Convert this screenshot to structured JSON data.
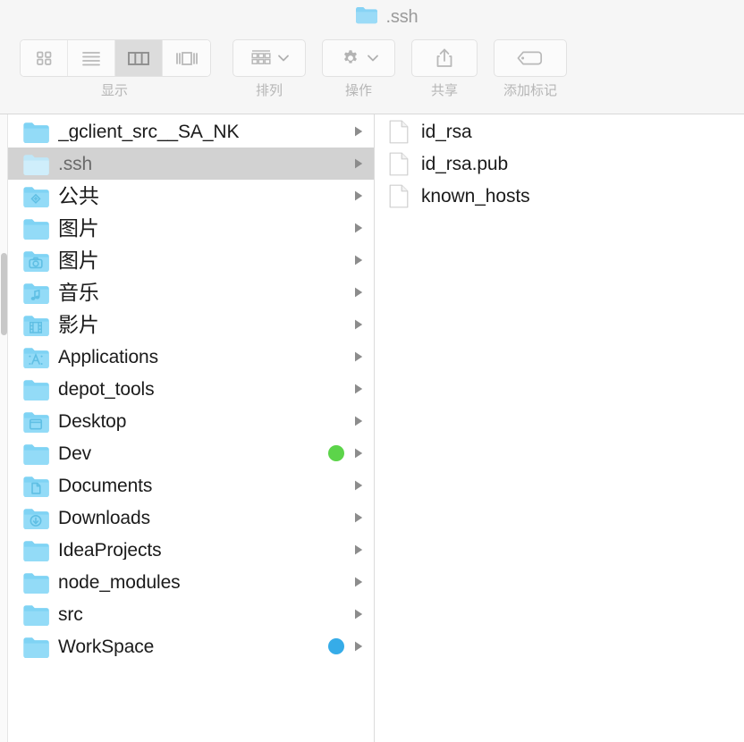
{
  "window": {
    "title": ".ssh",
    "title_icon": "folder-icon"
  },
  "toolbar": {
    "view_group": {
      "label": "显示",
      "options": [
        {
          "name": "icon-view",
          "icon": "grid-icon",
          "active": false
        },
        {
          "name": "list-view",
          "icon": "list-icon",
          "active": false
        },
        {
          "name": "column-view",
          "icon": "columns-icon",
          "active": true
        },
        {
          "name": "gallery-view",
          "icon": "gallery-icon",
          "active": false
        }
      ]
    },
    "arrange": {
      "label": "排列",
      "icon": "arrange-grid-icon",
      "chevron": "chevron-down-icon"
    },
    "action": {
      "label": "操作",
      "icon": "gear-icon",
      "chevron": "chevron-down-icon"
    },
    "share": {
      "label": "共享",
      "icon": "share-icon"
    },
    "tags": {
      "label": "添加标记",
      "icon": "tag-icon"
    }
  },
  "columns": {
    "folders": [
      {
        "name": "_gclient_src__SA_NK",
        "icon": "folder-plain-icon",
        "selected": false,
        "tag": null,
        "cjk": false
      },
      {
        "name": ".ssh",
        "icon": "folder-plain-icon",
        "selected": true,
        "tag": null,
        "cjk": false
      },
      {
        "name": "公共",
        "icon": "folder-public-icon",
        "selected": false,
        "tag": null,
        "cjk": true
      },
      {
        "name": "图片",
        "icon": "folder-plain-icon",
        "selected": false,
        "tag": null,
        "cjk": true
      },
      {
        "name": "图片",
        "icon": "folder-camera-icon",
        "selected": false,
        "tag": null,
        "cjk": true
      },
      {
        "name": "音乐",
        "icon": "folder-music-icon",
        "selected": false,
        "tag": null,
        "cjk": true
      },
      {
        "name": "影片",
        "icon": "folder-movies-icon",
        "selected": false,
        "tag": null,
        "cjk": true
      },
      {
        "name": "Applications",
        "icon": "folder-applications-icon",
        "selected": false,
        "tag": null,
        "cjk": false
      },
      {
        "name": "depot_tools",
        "icon": "folder-plain-icon",
        "selected": false,
        "tag": null,
        "cjk": false
      },
      {
        "name": "Desktop",
        "icon": "folder-desktop-icon",
        "selected": false,
        "tag": null,
        "cjk": false
      },
      {
        "name": "Dev",
        "icon": "folder-plain-icon",
        "selected": false,
        "tag": "#5cd44a",
        "cjk": false
      },
      {
        "name": "Documents",
        "icon": "folder-documents-icon",
        "selected": false,
        "tag": null,
        "cjk": false
      },
      {
        "name": "Downloads",
        "icon": "folder-downloads-icon",
        "selected": false,
        "tag": null,
        "cjk": false
      },
      {
        "name": "IdeaProjects",
        "icon": "folder-plain-icon",
        "selected": false,
        "tag": null,
        "cjk": false
      },
      {
        "name": "node_modules",
        "icon": "folder-plain-icon",
        "selected": false,
        "tag": null,
        "cjk": false
      },
      {
        "name": "src",
        "icon": "folder-plain-icon",
        "selected": false,
        "tag": null,
        "cjk": false
      },
      {
        "name": "WorkSpace",
        "icon": "folder-plain-icon",
        "selected": false,
        "tag": "#36ace8",
        "cjk": false
      }
    ],
    "files": [
      {
        "name": "id_rsa",
        "icon": "document-icon"
      },
      {
        "name": "id_rsa.pub",
        "icon": "document-icon"
      },
      {
        "name": "known_hosts",
        "icon": "document-icon"
      }
    ]
  },
  "colors": {
    "folder_blue": "#6fd0f5",
    "selection_gray": "#d2d2d2",
    "toolbar_bg": "#f6f6f6",
    "label_gray": "#b6b6b6"
  }
}
